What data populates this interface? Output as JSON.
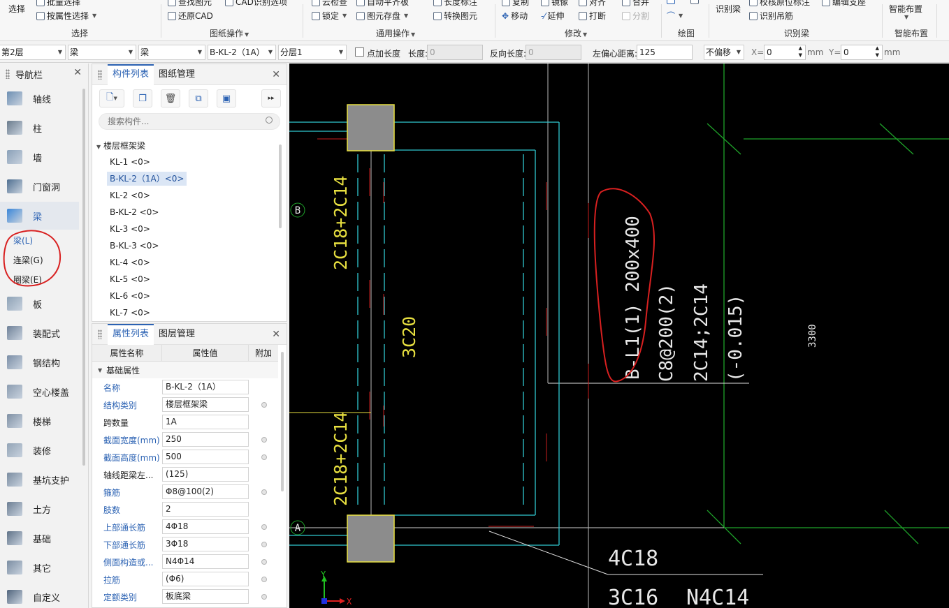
{
  "ribbon": {
    "select_big": "选择",
    "batch_select": "批量选择",
    "attr_select": "按属性选择",
    "group_select": "选择",
    "find_graphic": "查找图元",
    "cad_recognize": "CAD识别选项",
    "restore_cad": "还原CAD",
    "group_drawing": "图纸操作",
    "cloud_check": "云检查",
    "auto_flat": "自动平齐板",
    "length_mark": "长度标注",
    "lock": "锁定",
    "save_element": "图元存盘",
    "convert_element": "转换图元",
    "group_common": "通用操作",
    "copy": "复制",
    "mirror": "镜像",
    "align": "对齐",
    "merge": "合并",
    "move": "移动",
    "extend": "延伸",
    "break": "打断",
    "split": "分割",
    "group_modify": "修改",
    "group_draw": "绘图",
    "recognize_beam": "识别梁",
    "check_seat": "校核原位标注",
    "edit_support": "编辑支座",
    "recognize_hanger": "识别吊筋",
    "group_recognize_beam": "识别梁",
    "smart_layout": "智能布置",
    "group_smart": "智能布置"
  },
  "propbar": {
    "floor": "第2层",
    "category": "梁",
    "type": "梁",
    "component": "B-KL-2（1A）",
    "layer": "分层1",
    "add_length_label": "点加长度",
    "length_label": "长度:",
    "length_value": "0",
    "reverse_length_label": "反向长度:",
    "reverse_length_value": "0",
    "left_offset_label": "左偏心距离:",
    "left_offset_value": "125",
    "offset_mode": "不偏移",
    "x_label": "X=",
    "x_value": "0",
    "y_label": "Y=",
    "y_value": "0",
    "unit": "mm"
  },
  "nav": {
    "title": "导航栏",
    "items": [
      {
        "label": "轴线",
        "icon": "axis-grid-icon"
      },
      {
        "label": "柱",
        "icon": "column-icon"
      },
      {
        "label": "墙",
        "icon": "wall-icon"
      },
      {
        "label": "门窗洞",
        "icon": "door-window-icon"
      },
      {
        "label": "梁",
        "icon": "beam-icon"
      },
      {
        "label": "板",
        "icon": "slab-icon"
      },
      {
        "label": "装配式",
        "icon": "prefab-icon"
      },
      {
        "label": "钢结构",
        "icon": "steel-structure-icon"
      },
      {
        "label": "空心楼盖",
        "icon": "hollow-floor-icon"
      },
      {
        "label": "楼梯",
        "icon": "stair-icon"
      },
      {
        "label": "装修",
        "icon": "decoration-icon"
      },
      {
        "label": "基坑支护",
        "icon": "foundation-pit-icon"
      },
      {
        "label": "土方",
        "icon": "earthwork-icon"
      },
      {
        "label": "基础",
        "icon": "foundation-icon"
      },
      {
        "label": "其它",
        "icon": "other-icon"
      },
      {
        "label": "自定义",
        "icon": "custom-icon"
      }
    ],
    "sub_items": [
      "梁(L)",
      "连梁(G)",
      "圈梁(E)"
    ]
  },
  "components": {
    "tab_list": "构件列表",
    "tab_drawing": "图纸管理",
    "search_placeholder": "搜索构件...",
    "root": "楼层框架梁",
    "items": [
      "KL-1 <0>",
      "B-KL-2（1A）<0>",
      "KL-2 <0>",
      "B-KL-2 <0>",
      "KL-3 <0>",
      "B-KL-3 <0>",
      "KL-4 <0>",
      "KL-5 <0>",
      "KL-6 <0>",
      "KL-7 <0>"
    ]
  },
  "properties": {
    "tab_props": "属性列表",
    "tab_layers": "图层管理",
    "col_name": "属性名称",
    "col_value": "属性值",
    "col_extra": "附加",
    "group": "基础属性",
    "rows": [
      {
        "name": "名称",
        "value": "B-KL-2（1A）"
      },
      {
        "name": "结构类别",
        "value": "楼层框架梁"
      },
      {
        "name": "跨数量",
        "value": "1A"
      },
      {
        "name": "截面宽度(mm)",
        "value": "250"
      },
      {
        "name": "截面高度(mm)",
        "value": "500"
      },
      {
        "name": "轴线距梁左...",
        "value": "(125)"
      },
      {
        "name": "箍筋",
        "value": "Φ8@100(2)"
      },
      {
        "name": "肢数",
        "value": "2"
      },
      {
        "name": "上部通长筋",
        "value": "4Φ18"
      },
      {
        "name": "下部通长筋",
        "value": "3Φ18"
      },
      {
        "name": "侧面构造或...",
        "value": "N4Φ14"
      },
      {
        "name": "拉筋",
        "value": "(Φ6)"
      },
      {
        "name": "定额类别",
        "value": "板底梁"
      }
    ]
  },
  "canvas": {
    "axis_b": "B",
    "axis_a": "A",
    "top_rebar_upper": "2C18+2C14",
    "top_rebar_lower": "2C18+2C14",
    "middle_rebar": "3C20",
    "beam_spec": "B-L1(1) 200x400",
    "stirrup": "C8@200(2)",
    "long_rebar": "2C14;2C14",
    "elevation": "(-0.015)",
    "dimension": "3300",
    "note_top": "4C18",
    "note_bottom": "3C16",
    "note_side": "N4C14",
    "ucs_x": "X",
    "ucs_y": "Y",
    "colors": {
      "cyan": "#30c8d0",
      "yellow": "#e8e040",
      "green": "#1fa32a",
      "red": "#c81e1e",
      "white": "#e8e8e8",
      "column_fill": "#8c8c8c"
    }
  }
}
